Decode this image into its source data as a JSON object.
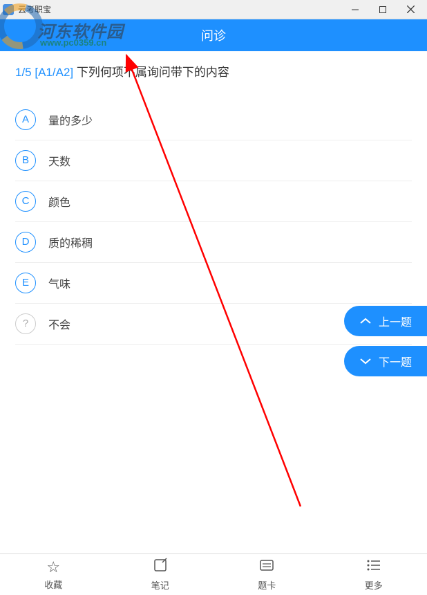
{
  "titlebar": {
    "title": "云考职宝"
  },
  "header": {
    "title": "问诊"
  },
  "question": {
    "number": "1/5",
    "type": "[A1/A2]",
    "text": "下列何项不属询问带下的内容"
  },
  "options": [
    {
      "letter": "A",
      "text": "量的多少"
    },
    {
      "letter": "B",
      "text": "天数"
    },
    {
      "letter": "C",
      "text": "颜色"
    },
    {
      "letter": "D",
      "text": "质的稀稠"
    },
    {
      "letter": "E",
      "text": "气味"
    },
    {
      "letter": "?",
      "text": "不会"
    }
  ],
  "nav": {
    "prev": "上一题",
    "next": "下一题"
  },
  "tabs": [
    {
      "label": "收藏"
    },
    {
      "label": "笔记"
    },
    {
      "label": "题卡"
    },
    {
      "label": "更多"
    }
  ],
  "watermark": {
    "line1": "河东软件园",
    "line2": "www.pc0359.cn"
  }
}
